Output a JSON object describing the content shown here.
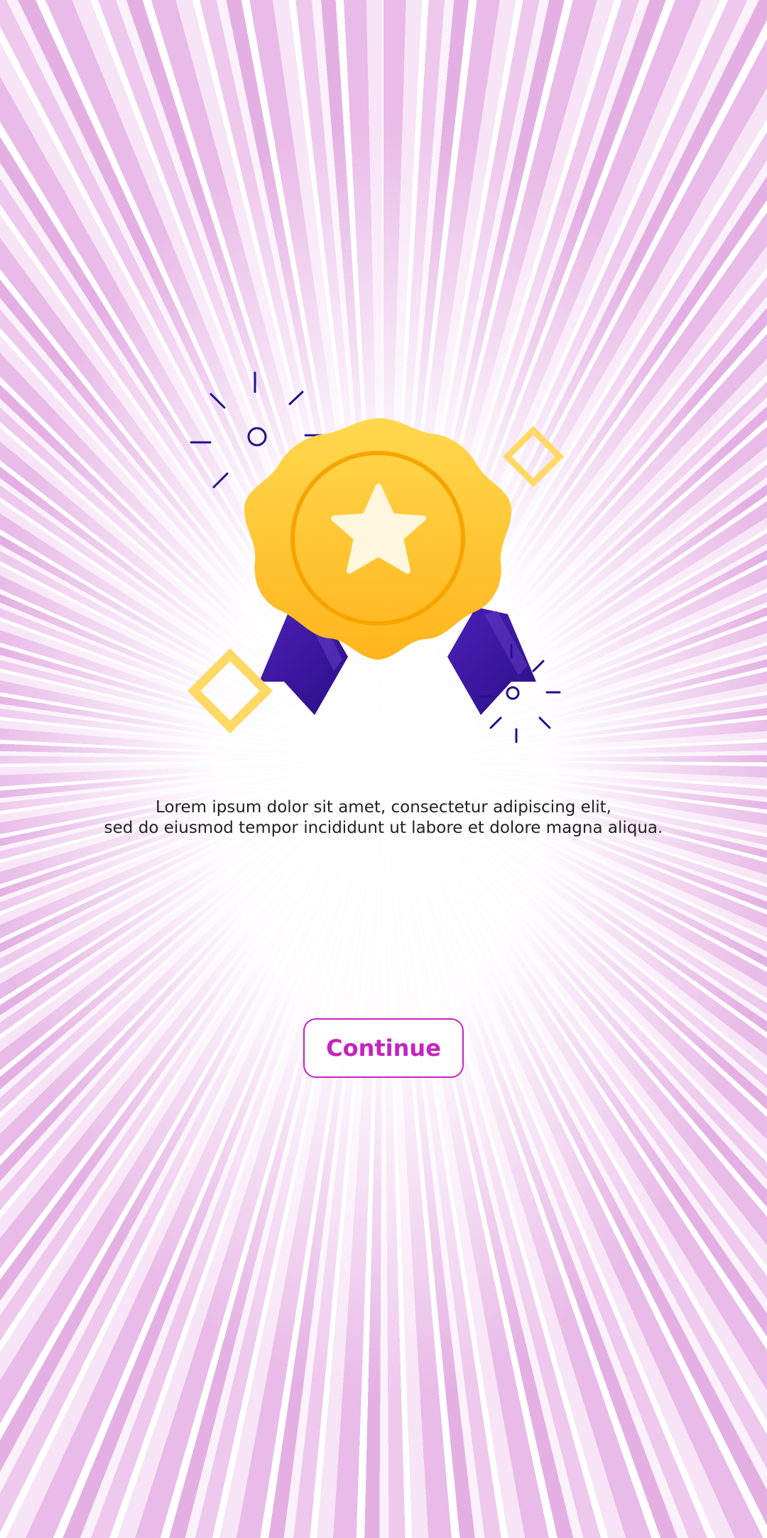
{
  "screen": {
    "background": "purple-white-radial-rays"
  },
  "illustration": {
    "name": "award-badge",
    "icons": [
      "medal-icon",
      "star-icon",
      "ribbon-icon",
      "sparkle-icon",
      "diamond-icon"
    ],
    "colors": {
      "medal": "#ffc52a",
      "medal_ring": "#f7a400",
      "star": "#fff6de",
      "ribbon": "#3a139d",
      "sparkle": "#21108d",
      "diamond": "#ffd966"
    }
  },
  "message": {
    "line1": "Lorem ipsum dolor sit amet, consectetur adipiscing elit,",
    "line2": "sed do eiusmod tempor incididunt ut labore et dolore magna aliqua."
  },
  "continue_button": {
    "label": "Continue",
    "color": "#c424bf"
  }
}
